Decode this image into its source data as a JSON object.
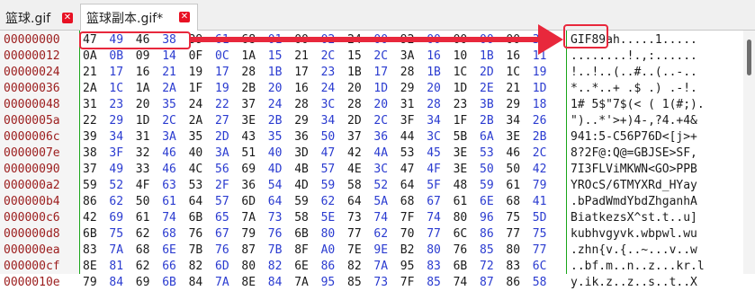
{
  "tabs": [
    {
      "label": "篮球.gif",
      "active": false
    },
    {
      "label": "篮球副本.gif*",
      "active": true
    }
  ],
  "icons": {
    "close": "close-icon"
  },
  "colors": {
    "accent": "#e8283c",
    "divider": "#1aa51a",
    "offset": "#9b1c1c",
    "byte_blue": "#2a3bd0"
  },
  "rows": [
    {
      "offset": "00000000",
      "bytes": [
        "47",
        "49",
        "46",
        "38",
        "39",
        "61",
        "68",
        "01",
        "00",
        "02",
        "24",
        "00",
        "92",
        "00",
        "00",
        "00",
        "00",
        "34"
      ],
      "ascii": "GIF89ah.....1....."
    },
    {
      "offset": "00000012",
      "bytes": [
        "0A",
        "0B",
        "09",
        "14",
        "0F",
        "0C",
        "1A",
        "15",
        "21",
        "2C",
        "15",
        "2C",
        "3A",
        "16",
        "10",
        "1B",
        "16",
        "11"
      ],
      "ascii": "........!.,:......"
    },
    {
      "offset": "00000024",
      "bytes": [
        "21",
        "17",
        "16",
        "21",
        "19",
        "17",
        "28",
        "1B",
        "17",
        "23",
        "1B",
        "17",
        "28",
        "1B",
        "1C",
        "2D",
        "1C",
        "19"
      ],
      "ascii": "!..!..(..#..(..-.."
    },
    {
      "offset": "00000036",
      "bytes": [
        "2A",
        "1C",
        "1A",
        "2A",
        "1F",
        "19",
        "2B",
        "20",
        "16",
        "24",
        "20",
        "1D",
        "29",
        "20",
        "1D",
        "2E",
        "21",
        "1D"
      ],
      "ascii": "*..*..+ .$ .) .-!."
    },
    {
      "offset": "00000048",
      "bytes": [
        "31",
        "23",
        "20",
        "35",
        "24",
        "22",
        "37",
        "24",
        "28",
        "3C",
        "28",
        "20",
        "31",
        "28",
        "23",
        "3B",
        "29",
        "18"
      ],
      "ascii": "1# 5$\"7$(< ( 1(#;)."
    },
    {
      "offset": "0000005a",
      "bytes": [
        "22",
        "29",
        "1D",
        "2C",
        "2A",
        "27",
        "3E",
        "2B",
        "29",
        "34",
        "2D",
        "2C",
        "3F",
        "34",
        "1F",
        "2B",
        "34",
        "26"
      ],
      "ascii": "\")..*'>+)4-,?4.+4&"
    },
    {
      "offset": "0000006c",
      "bytes": [
        "39",
        "34",
        "31",
        "3A",
        "35",
        "2D",
        "43",
        "35",
        "36",
        "50",
        "37",
        "36",
        "44",
        "3C",
        "5B",
        "6A",
        "3E",
        "2B"
      ],
      "ascii": "941:5-C56P76D<[j>+"
    },
    {
      "offset": "0000007e",
      "bytes": [
        "38",
        "3F",
        "32",
        "46",
        "40",
        "3A",
        "51",
        "40",
        "3D",
        "47",
        "42",
        "4A",
        "53",
        "45",
        "3E",
        "53",
        "46",
        "2C"
      ],
      "ascii": "8?2F@:Q@=GBJSE>SF,"
    },
    {
      "offset": "00000090",
      "bytes": [
        "37",
        "49",
        "33",
        "46",
        "4C",
        "56",
        "69",
        "4D",
        "4B",
        "57",
        "4E",
        "3C",
        "47",
        "4F",
        "3E",
        "50",
        "50",
        "42"
      ],
      "ascii": "7I3FLViMKWN<GO>PPB"
    },
    {
      "offset": "000000a2",
      "bytes": [
        "59",
        "52",
        "4F",
        "63",
        "53",
        "2F",
        "36",
        "54",
        "4D",
        "59",
        "58",
        "52",
        "64",
        "5F",
        "48",
        "59",
        "61",
        "79"
      ],
      "ascii": "YROcS/6TMYXRd_HYay"
    },
    {
      "offset": "000000b4",
      "bytes": [
        "86",
        "62",
        "50",
        "61",
        "64",
        "57",
        "6D",
        "64",
        "59",
        "62",
        "64",
        "5A",
        "68",
        "67",
        "61",
        "6E",
        "68",
        "41"
      ],
      "ascii": ".bPadWmdYbdZhganhA"
    },
    {
      "offset": "000000c6",
      "bytes": [
        "42",
        "69",
        "61",
        "74",
        "6B",
        "65",
        "7A",
        "73",
        "58",
        "5E",
        "73",
        "74",
        "7F",
        "74",
        "80",
        "96",
        "75",
        "5D"
      ],
      "ascii": "BiatkezsX^st.t..u]"
    },
    {
      "offset": "000000d8",
      "bytes": [
        "6B",
        "75",
        "62",
        "68",
        "76",
        "67",
        "79",
        "76",
        "6B",
        "80",
        "77",
        "62",
        "70",
        "77",
        "6C",
        "86",
        "77",
        "75"
      ],
      "ascii": "kubhvgyvk.wbpwl.wu"
    },
    {
      "offset": "000000ea",
      "bytes": [
        "83",
        "7A",
        "68",
        "6E",
        "7B",
        "76",
        "87",
        "7B",
        "8F",
        "A0",
        "7E",
        "9E",
        "B2",
        "80",
        "76",
        "85",
        "80",
        "77"
      ],
      "ascii": ".zhn{v.{..~...v..w"
    },
    {
      "offset": "000000cf",
      "bytes": [
        "8E",
        "81",
        "62",
        "66",
        "82",
        "6D",
        "80",
        "82",
        "6E",
        "86",
        "82",
        "7A",
        "95",
        "83",
        "6B",
        "72",
        "83",
        "6C"
      ],
      "ascii": "..bf.m..n..z...kr.l"
    },
    {
      "offset": "0000010e",
      "bytes": [
        "79",
        "84",
        "69",
        "6B",
        "84",
        "7A",
        "8E",
        "84",
        "7A",
        "95",
        "85",
        "73",
        "7F",
        "85",
        "74",
        "87",
        "86",
        "58"
      ],
      "ascii": "y.ik.z..z..s..t..X"
    }
  ]
}
